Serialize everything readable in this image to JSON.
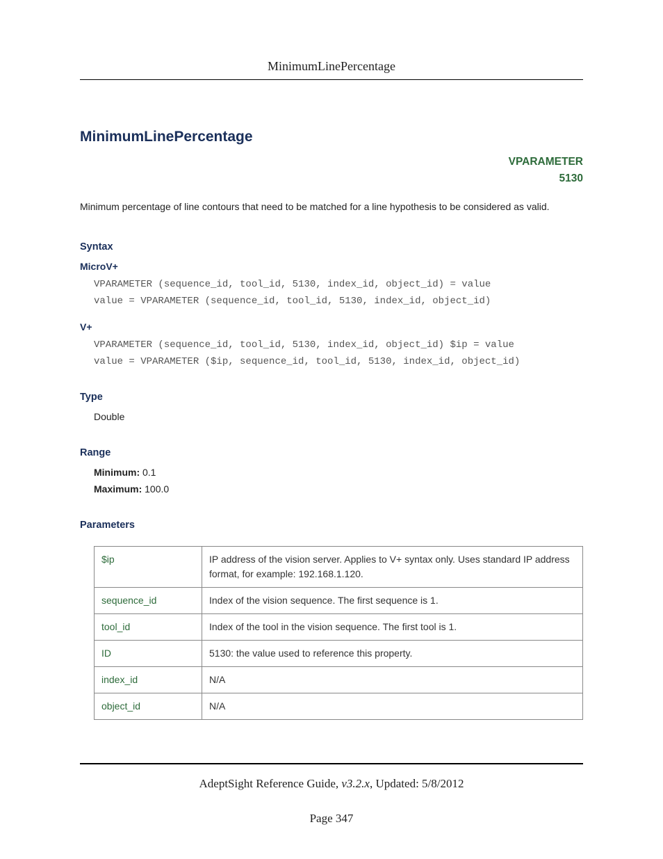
{
  "header": {
    "topic": "MinimumLinePercentage"
  },
  "title": "MinimumLinePercentage",
  "vparameter": {
    "label": "VPARAMETER",
    "code": "5130"
  },
  "intro": "Minimum percentage of line contours that need to be matched for a line hypothesis to be considered as valid.",
  "syntax": {
    "heading": "Syntax",
    "microv": {
      "heading": "MicroV+",
      "code": "VPARAMETER (sequence_id, tool_id, 5130, index_id, object_id) = value\nvalue = VPARAMETER (sequence_id, tool_id, 5130, index_id, object_id)"
    },
    "vplus": {
      "heading": "V+",
      "code": "VPARAMETER (sequence_id, tool_id, 5130, index_id, object_id) $ip = value\nvalue = VPARAMETER ($ip, sequence_id, tool_id, 5130, index_id, object_id)"
    }
  },
  "type": {
    "heading": "Type",
    "value": "Double"
  },
  "range": {
    "heading": "Range",
    "min_label": "Minimum:",
    "min_value": "0.1",
    "max_label": "Maximum:",
    "max_value": "100.0"
  },
  "parameters": {
    "heading": "Parameters",
    "rows": [
      {
        "name": "$ip",
        "desc": "IP address of the vision server. Applies to V+ syntax only. Uses standard IP address format, for example: 192.168.1.120."
      },
      {
        "name": "sequence_id",
        "desc": "Index of the vision sequence. The first sequence is 1."
      },
      {
        "name": "tool_id",
        "desc": "Index of the tool in the vision sequence. The first tool is 1."
      },
      {
        "name": "ID",
        "desc": "5130: the value used to reference this property."
      },
      {
        "name": "index_id",
        "desc": "N/A"
      },
      {
        "name": "object_id",
        "desc": "N/A"
      }
    ]
  },
  "footer": {
    "guide": "AdeptSight Reference Guide",
    "version": ", v3.2.x",
    "updated": ", Updated: 5/8/2012",
    "page": "Page 347"
  }
}
